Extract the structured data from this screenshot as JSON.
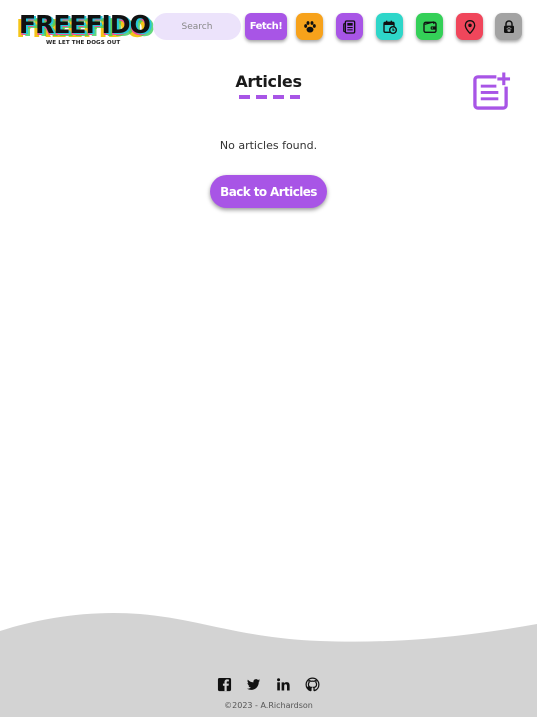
{
  "brand": {
    "logo_text": "FREEFIDO",
    "tagline": "WE LET THE DOGS OUT"
  },
  "header": {
    "search_placeholder": "Search",
    "fetch_label": "Fetch!",
    "nav_buttons": [
      {
        "icon": "paw-icon",
        "color": "#f7a21b"
      },
      {
        "icon": "newspaper-icon",
        "color": "#a855e6"
      },
      {
        "icon": "calendar-clock-icon",
        "color": "#2ed6c9"
      },
      {
        "icon": "wallet-icon",
        "color": "#34d058"
      },
      {
        "icon": "map-pin-icon",
        "color": "#f0465b"
      },
      {
        "icon": "lock-paw-icon",
        "color": "#a3a3a3"
      }
    ]
  },
  "main": {
    "title": "Articles",
    "empty_message": "No articles found.",
    "back_button_label": "Back to Articles",
    "accent_color": "#a855e6"
  },
  "footer": {
    "social_icons": [
      "facebook-icon",
      "twitter-icon",
      "linkedin-icon",
      "github-icon"
    ],
    "copyright": "©2023 - A.Richardson",
    "background_color": "#d3d3d3"
  }
}
